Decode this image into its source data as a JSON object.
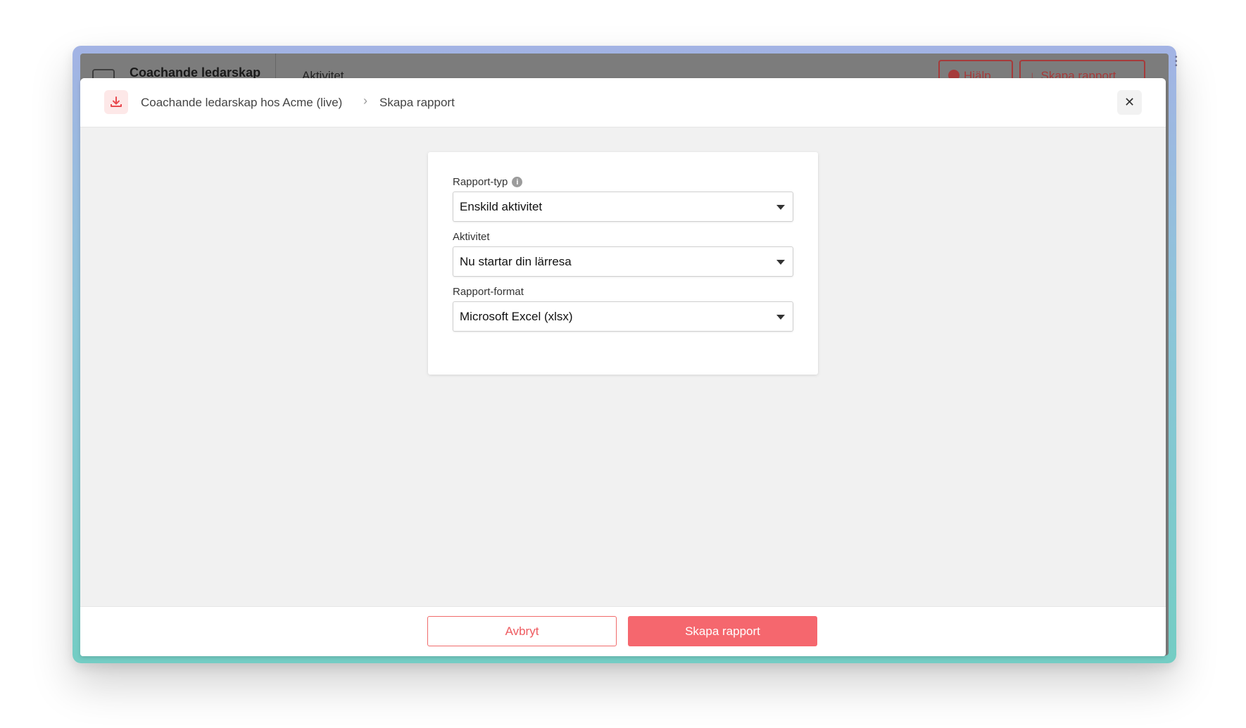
{
  "background_app": {
    "title": "Coachande ledarskap",
    "tab": "Aktivitet",
    "help_button": "Hjälp",
    "create_button": "Skapa rapport"
  },
  "modal": {
    "breadcrumb": {
      "parent": "Coachande ledarskap hos Acme (live)",
      "current": "Skapa rapport"
    },
    "close_icon": "close-icon",
    "header_icon": "download-icon",
    "form": {
      "report_type": {
        "label": "Rapport-typ",
        "value": "Enskild aktivitet"
      },
      "activity": {
        "label": "Aktivitet",
        "value": "Nu startar din lärresa"
      },
      "report_format": {
        "label": "Rapport-format",
        "value": "Microsoft Excel (xlsx)"
      }
    },
    "footer": {
      "cancel_label": "Avbryt",
      "submit_label": "Skapa rapport"
    }
  },
  "colors": {
    "accent": "#f5676e",
    "accent_text": "#ee5a5f",
    "modal_body": "#f1f1f1"
  }
}
